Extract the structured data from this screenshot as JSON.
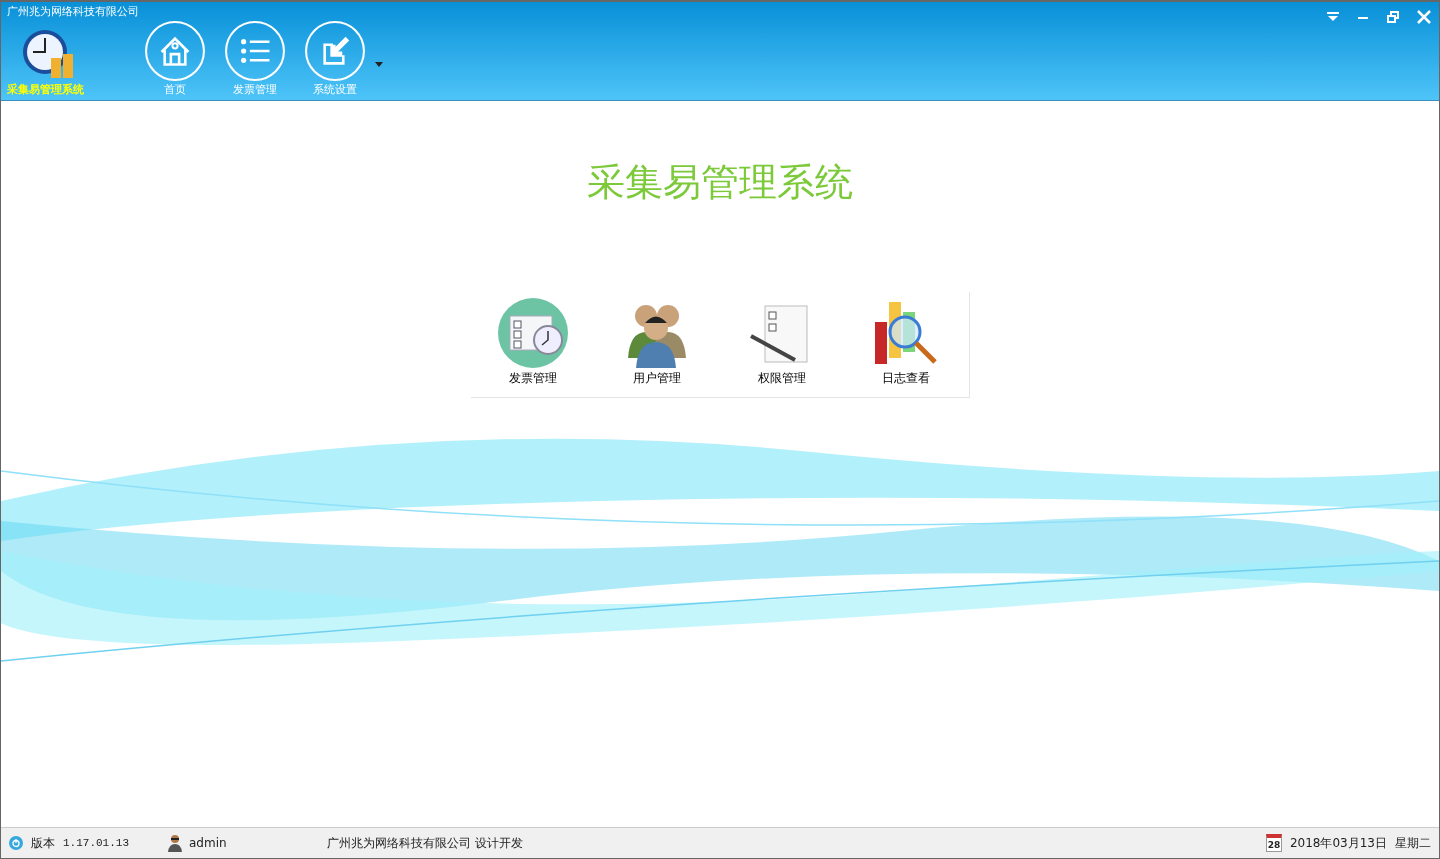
{
  "window": {
    "title": "广州兆为网络科技有限公司"
  },
  "app_logo": {
    "label": "采集易管理系统"
  },
  "toolbar": [
    {
      "label": "首页",
      "kind": "home"
    },
    {
      "label": "发票管理",
      "kind": "list"
    },
    {
      "label": "系统设置",
      "kind": "settings"
    }
  ],
  "main": {
    "heading": "采集易管理系统",
    "modules": [
      {
        "label": "发票管理",
        "kind": "invoice"
      },
      {
        "label": "用户管理",
        "kind": "users"
      },
      {
        "label": "权限管理",
        "kind": "permissions"
      },
      {
        "label": "日志查看",
        "kind": "logs"
      }
    ]
  },
  "status_bar": {
    "version_label": "版本",
    "version": "1.17.01.13",
    "user": "admin",
    "credit": "广州兆为网络科技有限公司 设计开发",
    "calendar_day": "28",
    "date": "2018年03月13日",
    "weekday": "星期二"
  }
}
